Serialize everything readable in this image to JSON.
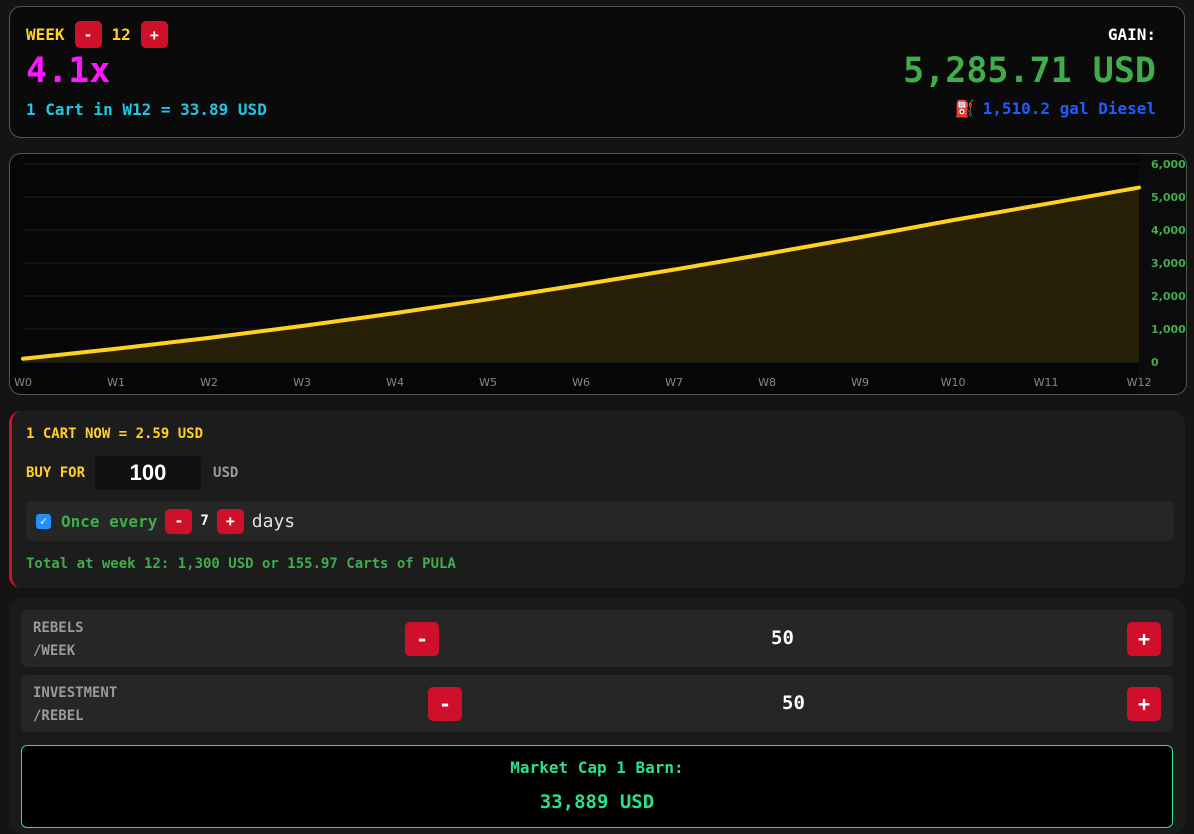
{
  "header": {
    "week_label": "WEEK",
    "week_minus": "-",
    "week_value": "12",
    "week_plus": "+",
    "multiplier": "4.1x",
    "cart_in_week": "1 Cart in W12 = 33.89 USD",
    "gain_label": "GAIN:",
    "gain_value": "5,285.71 USD",
    "fuel_icon": "⛽",
    "diesel": "1,510.2 gal Diesel"
  },
  "chart_data": {
    "type": "area",
    "x": [
      "W0",
      "W1",
      "W2",
      "W3",
      "W4",
      "W5",
      "W6",
      "W7",
      "W8",
      "W9",
      "W10",
      "W11",
      "W12"
    ],
    "values": [
      100,
      400,
      730,
      1090,
      1480,
      1900,
      2340,
      2800,
      3280,
      3780,
      4300,
      4790,
      5285.71
    ],
    "ylim": [
      0,
      6000
    ],
    "yticks": [
      "0",
      "1,000",
      "2,000",
      "3,000",
      "4,000",
      "5,000",
      "6,000"
    ],
    "ytick_values": [
      0,
      1000,
      2000,
      3000,
      4000,
      5000,
      6000
    ],
    "grid": true,
    "line_color": "#ffd21f",
    "fill_color": "#2a2106",
    "ytick_color": "#3fae4a",
    "xtick_color": "#888888"
  },
  "buy": {
    "cart_now": "1 CART NOW = 2.59 USD",
    "buy_for_label": "BUY FOR",
    "buy_for_value": "100",
    "usd_unit": "USD",
    "checkbox_mark": "✓",
    "once_every": "Once every",
    "days_minus": "-",
    "days_value": "7",
    "days_plus": "+",
    "days_label": "days",
    "total": "Total at week 12: 1,300 USD or 155.97 Carts of PULA"
  },
  "params": {
    "rebels_label_1": "REBELS",
    "rebels_label_2": "/WEEK",
    "rebels_minus": "-",
    "rebels_value": "50",
    "rebels_plus": "+",
    "investment_label_1": "INVESTMENT",
    "investment_label_2": "/REBEL",
    "investment_minus": "-",
    "investment_value": "50",
    "investment_plus": "+",
    "mcap_label": "Market Cap 1 Barn:",
    "mcap_value": "33,889 USD"
  },
  "colors": {
    "accent_red": "#d0102a",
    "yellow": "#ffd21f",
    "magenta": "#ff17ff",
    "green": "#3fae4a",
    "mint": "#2ae08a",
    "cyan": "#1fc7e6",
    "blue": "#1f5cff"
  }
}
